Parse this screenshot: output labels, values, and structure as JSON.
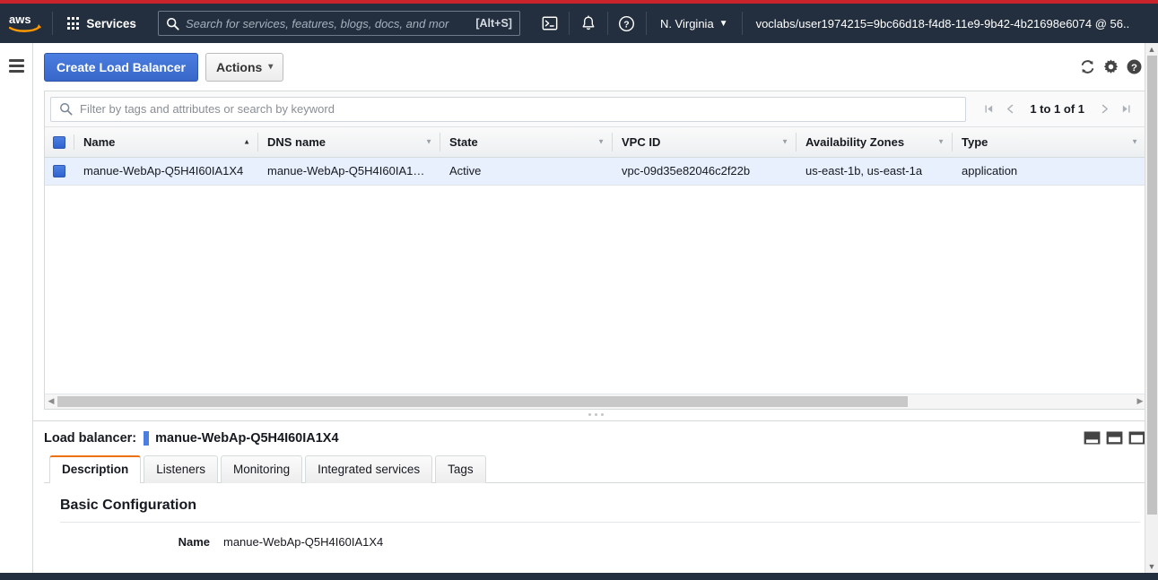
{
  "navbar": {
    "logo_alt": "aws",
    "services_label": "Services",
    "search_placeholder": "Search for services, features, blogs, docs, and mor",
    "search_shortcut": "[Alt+S]",
    "cloudshell_icon": "cloudshell-icon",
    "bell_icon": "bell-icon",
    "help_icon": "help-circle-icon",
    "region_label": "N. Virginia",
    "account_label": "voclabs/user1974215=9bc66d18-f4d8-11e9-9b42-4b21698e6074 @ 56...",
    "caret": "▼",
    "stripe_color": "#c9232b",
    "bg_color": "#232f3e"
  },
  "toolbar": {
    "create_label": "Create Load Balancer",
    "actions_label": "Actions",
    "actions_caret": "⌄",
    "refresh_icon": "refresh-icon",
    "settings_icon": "gear-icon",
    "help_icon": "help-circle-icon",
    "primary_color": "#3f70d4"
  },
  "filter": {
    "placeholder": "Filter by tags and attributes or search by keyword",
    "value": "",
    "search_icon": "search-icon"
  },
  "pagination": {
    "first_label": "|◀",
    "prev_label": "◀",
    "range_label": "1 to 1 of 1",
    "next_label": "▶",
    "last_label": "▶|"
  },
  "table": {
    "columns": [
      {
        "label": "Name",
        "sort": "asc"
      },
      {
        "label": "DNS name",
        "sort": "none"
      },
      {
        "label": "State",
        "sort": "none"
      },
      {
        "label": "VPC ID",
        "sort": "none"
      },
      {
        "label": "Availability Zones",
        "sort": "none"
      },
      {
        "label": "Type",
        "sort": "none"
      }
    ],
    "rows": [
      {
        "selected": true,
        "name": "manue-WebAp-Q5H4I60IA1X4",
        "dns_name": "manue-WebAp-Q5H4I60IA1…",
        "state": "Active",
        "vpc_id": "vpc-09d35e82046c2f22b",
        "availability_zones": "us-east-1b, us-east-1a",
        "type": "application"
      }
    ]
  },
  "detail": {
    "header_label": "Load balancer:",
    "header_name": "manue-WebAp-Q5H4I60IA1X4",
    "layout_icons": [
      "panel-bottom-icon",
      "panel-split-icon",
      "panel-side-icon"
    ],
    "tabs": [
      {
        "label": "Description",
        "active": true
      },
      {
        "label": "Listeners",
        "active": false
      },
      {
        "label": "Monitoring",
        "active": false
      },
      {
        "label": "Integrated services",
        "active": false
      },
      {
        "label": "Tags",
        "active": false
      }
    ],
    "section_title": "Basic Configuration",
    "fields": [
      {
        "key": "Name",
        "value": "manue-WebAp-Q5H4I60IA1X4"
      }
    ],
    "active_tab_accent": "#ec7211"
  },
  "sidebar": {
    "hamburger_icon": "hamburger-menu-icon"
  }
}
